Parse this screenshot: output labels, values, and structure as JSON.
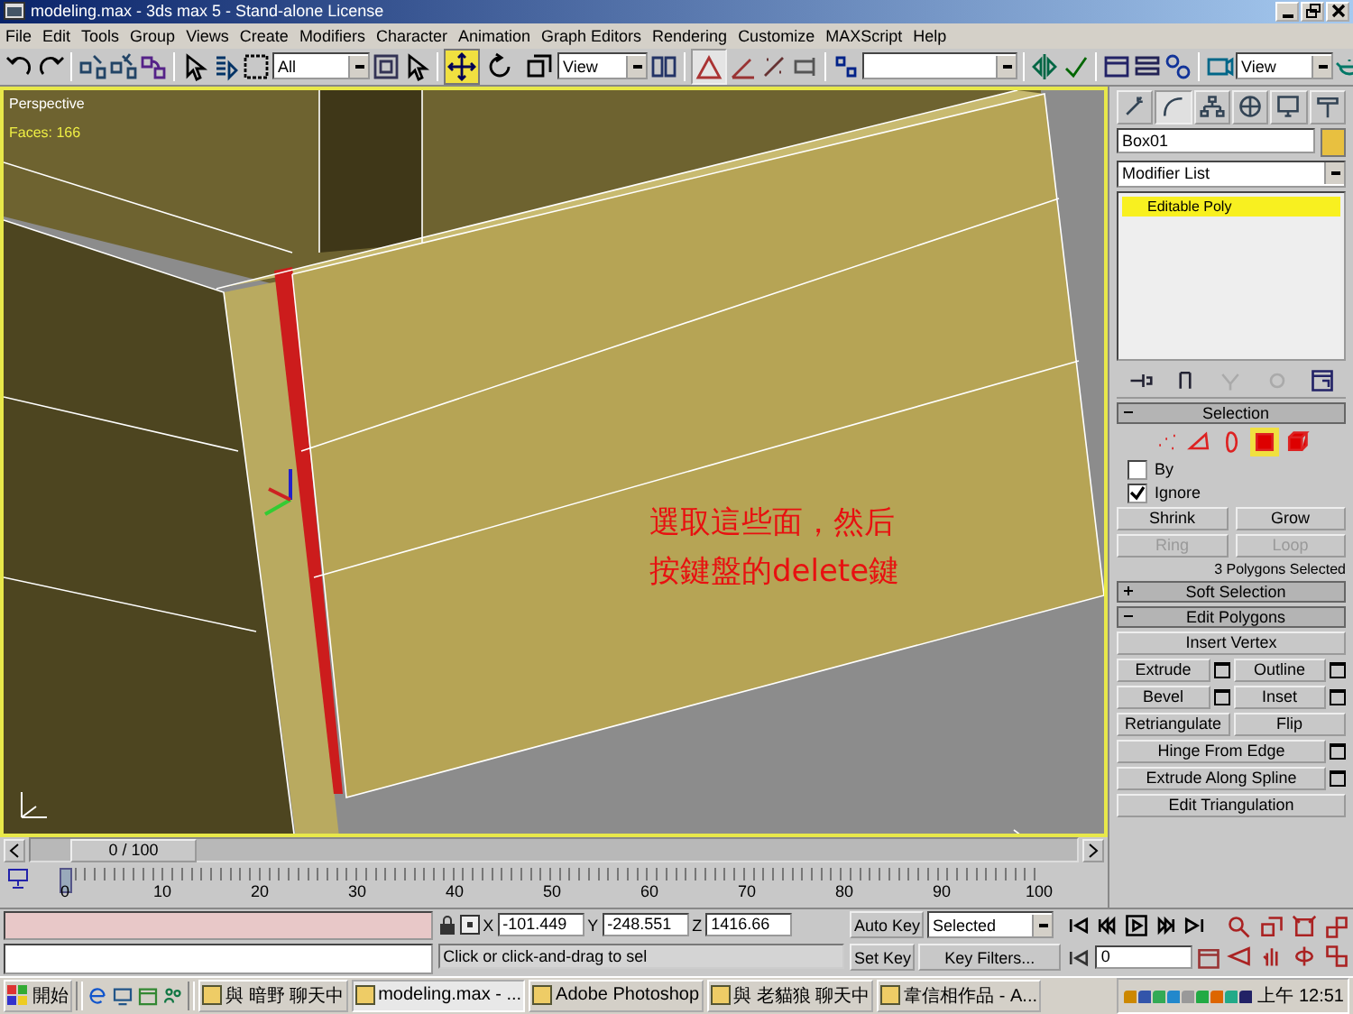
{
  "window": {
    "title": "modeling.max - 3ds max 5 - Stand-alone License"
  },
  "menu": [
    "File",
    "Edit",
    "Tools",
    "Group",
    "Views",
    "Create",
    "Modifiers",
    "Character",
    "Animation",
    "Graph Editors",
    "Rendering",
    "Customize",
    "MAXScript",
    "Help"
  ],
  "toolbar": {
    "selection_filter": "All",
    "transform_tools": [
      {
        "kind": "move",
        "selected": true
      },
      {
        "kind": "rotate",
        "selected": false
      },
      {
        "kind": "scale",
        "selected": false
      }
    ],
    "reference_coord": "View",
    "snap_toggle": {
      "on": true
    },
    "render_view": "View"
  },
  "viewport": {
    "label": "Perspective",
    "stats": "Faces: 166",
    "annotation": [
      "選取這些面，然后",
      "按鍵盤的delete鍵"
    ]
  },
  "command_panel": {
    "tabs": [
      {
        "kind": "create",
        "selected": false
      },
      {
        "kind": "modify",
        "selected": true
      },
      {
        "kind": "hierarchy",
        "selected": false
      },
      {
        "kind": "motion",
        "selected": false
      },
      {
        "kind": "display",
        "selected": false
      },
      {
        "kind": "utilities",
        "selected": false
      }
    ],
    "object_name": "Box01",
    "modifier_list": "Modifier List",
    "stack": [
      {
        "label": "Editable Poly",
        "selected": true
      }
    ],
    "selection": {
      "title": "Selection",
      "expanded": true,
      "subobject_levels": [
        {
          "kind": "vertex",
          "selected": false
        },
        {
          "kind": "edge",
          "selected": false
        },
        {
          "kind": "border",
          "selected": false
        },
        {
          "kind": "polygon",
          "selected": true
        },
        {
          "kind": "element",
          "selected": false
        }
      ],
      "options": [
        {
          "label": "By",
          "checked": false
        },
        {
          "label": "Ignore",
          "checked": true
        }
      ],
      "buttons": [
        {
          "label": "Shrink",
          "disabled": false
        },
        {
          "label": "Grow",
          "disabled": false
        },
        {
          "label": "Ring",
          "disabled": true
        },
        {
          "label": "Loop",
          "disabled": true
        }
      ],
      "status": "3 Polygons Selected"
    },
    "soft_selection": {
      "title": "Soft Selection",
      "expanded": false
    },
    "edit_polygons": {
      "title": "Edit Polygons",
      "expanded": true,
      "rows": [
        [
          {
            "label": "Insert Vertex",
            "settings": false
          }
        ],
        [
          {
            "label": "Extrude",
            "settings": true
          },
          {
            "label": "Outline",
            "settings": true
          }
        ],
        [
          {
            "label": "Bevel",
            "settings": true
          },
          {
            "label": "Inset",
            "settings": true
          }
        ],
        [
          {
            "label": "Retriangulate",
            "settings": false
          },
          {
            "label": "Flip",
            "settings": false
          }
        ],
        [
          {
            "label": "Hinge From Edge",
            "settings": true
          }
        ],
        [
          {
            "label": "Extrude Along Spline",
            "settings": true
          }
        ],
        [
          {
            "label": "Edit Triangulation",
            "settings": false
          }
        ]
      ]
    }
  },
  "time_slider": {
    "label": "0 / 100",
    "ticks": [
      "0",
      "10",
      "20",
      "30",
      "40",
      "50",
      "60",
      "70",
      "80",
      "90",
      "100"
    ]
  },
  "status_bar": {
    "prompt": "Click or click-and-drag to sel",
    "coords": [
      {
        "axis": "X",
        "value": "-101.449"
      },
      {
        "axis": "Y",
        "value": "-248.551"
      },
      {
        "axis": "Z",
        "value": "1416.66"
      }
    ],
    "auto_key": "Auto Key",
    "key_mode": "Selected",
    "set_key": "Set Key",
    "key_filters": "Key Filters...",
    "frame": "0"
  },
  "taskbar": {
    "start": "開始",
    "tasks": [
      {
        "label": "與 暗野 聊天中",
        "selected": false
      },
      {
        "label": "modeling.max - ...",
        "selected": true
      },
      {
        "label": "Adobe Photoshop",
        "selected": false
      },
      {
        "label": "與 老貓狼 聊天中",
        "selected": false
      },
      {
        "label": "韋信相作品 - A...",
        "selected": false
      }
    ],
    "clock": "上午 12:51"
  }
}
